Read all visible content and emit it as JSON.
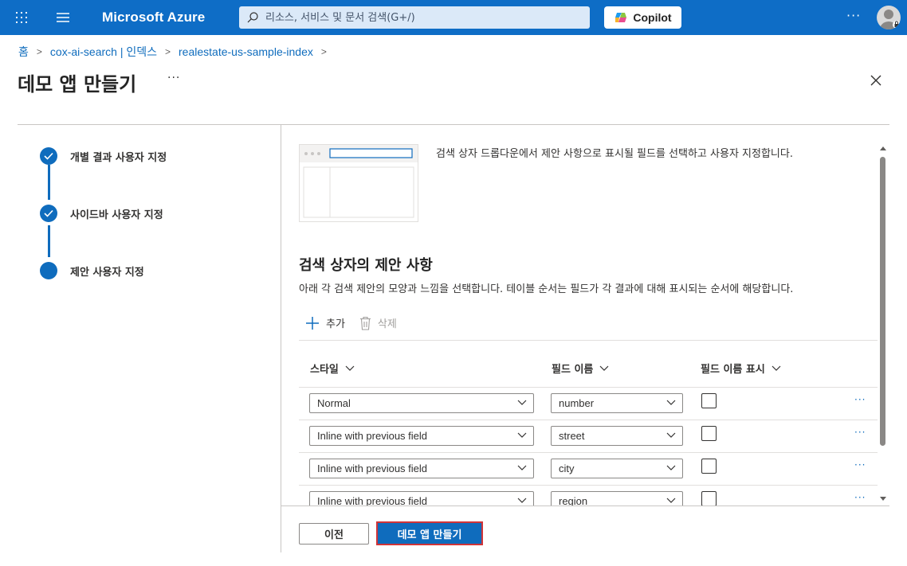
{
  "topbar": {
    "brand": "Microsoft Azure",
    "search_placeholder": "리소스, 서비스 및 문서 검색(G+/)",
    "copilot_label": "Copilot",
    "more": "···"
  },
  "breadcrumb": {
    "items": [
      "홈",
      "cox-ai-search | 인덱스",
      "realestate-us-sample-index"
    ]
  },
  "page": {
    "title": "데모 앱 만들기",
    "more": "···"
  },
  "steps": [
    {
      "label": "개별 결과 사용자 지정",
      "state": "done"
    },
    {
      "label": "사이드바 사용자 지정",
      "state": "done"
    },
    {
      "label": "제안 사용자 지정",
      "state": "current"
    }
  ],
  "main": {
    "intro": "검색 상자 드롭다운에서 제안 사항으로 표시될 필드를 선택하고 사용자 지정합니다.",
    "section_title": "검색 상자의 제안 사항",
    "section_desc": "아래 각 검색 제안의 모양과 느낌을 선택합니다. 테이블 순서는 필드가 각 결과에 대해 표시되는 순서에 해당합니다.",
    "toolbar": {
      "add": "추가",
      "delete": "삭제"
    },
    "table": {
      "columns": [
        "스타일",
        "필드 이름",
        "필드 이름 표시"
      ],
      "rows": [
        {
          "style": "Normal",
          "field": "number",
          "show_name": false,
          "more": "···"
        },
        {
          "style": "Inline with previous field",
          "field": "street",
          "show_name": false,
          "more": "···"
        },
        {
          "style": "Inline with previous field",
          "field": "city",
          "show_name": false,
          "more": "···"
        },
        {
          "style": "Inline with previous field",
          "field": "region",
          "show_name": false,
          "more": "···"
        }
      ]
    }
  },
  "footer": {
    "prev_label": "이전",
    "create_label": "데모 앱 만들기"
  },
  "colors": {
    "accent": "#0f6cbd",
    "highlight_border": "#d13438"
  }
}
